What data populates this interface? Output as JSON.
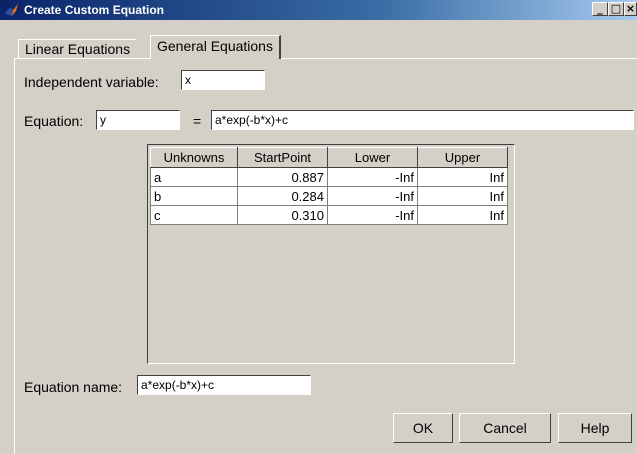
{
  "window": {
    "title": "Create Custom Equation",
    "controls": {
      "minimize": "_",
      "maximize": "□",
      "close": "×"
    }
  },
  "tabs": [
    {
      "label": "Linear Equations",
      "active": false
    },
    {
      "label": "General Equations",
      "active": true
    }
  ],
  "form": {
    "independent_label": "Independent variable:",
    "independent_value": "x",
    "equation_label": "Equation:",
    "equation_lhs": "y",
    "equals": "=",
    "equation_rhs": "a*exp(-b*x)+c",
    "name_label": "Equation name:",
    "name_value": "a*exp(-b*x)+c"
  },
  "coefficients": {
    "columns": [
      "Unknowns",
      "StartPoint",
      "Lower",
      "Upper"
    ],
    "rows": [
      [
        "a",
        "0.887",
        "-Inf",
        "Inf"
      ],
      [
        "b",
        "0.284",
        "-Inf",
        "Inf"
      ],
      [
        "c",
        "0.310",
        "-Inf",
        "Inf"
      ]
    ]
  },
  "buttons": {
    "ok": "OK",
    "cancel": "Cancel",
    "help": "Help"
  },
  "colors": {
    "titlebar": "#0a246a",
    "face": "#d4d0c8"
  },
  "icons": {
    "app": "matlab-membrane-icon"
  }
}
